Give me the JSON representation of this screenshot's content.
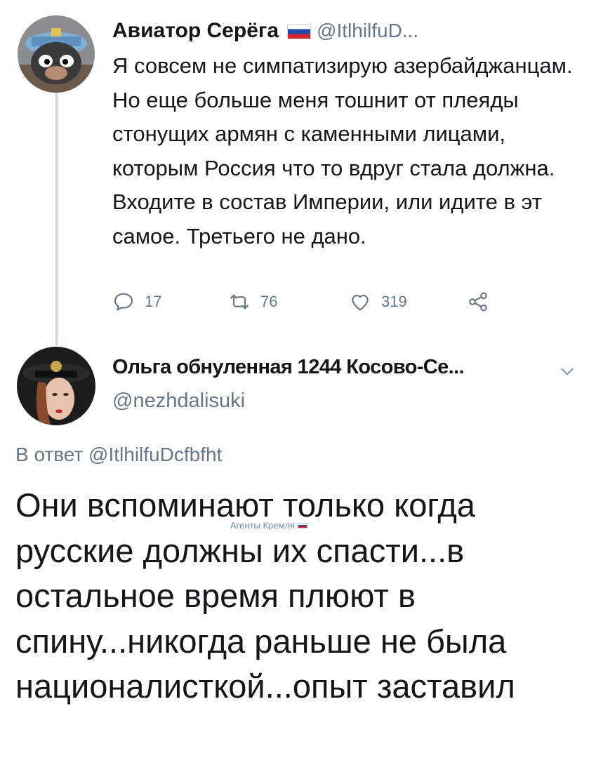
{
  "tweet1": {
    "author_name": "Авиатор Серёга",
    "flag_icon": "russia-flag",
    "handle": "@ItlhilfuD...",
    "text": "Я совсем не симпатизирую азербайджанцам. Но еще больше меня тошнит от плеяды стонущих армян с каменными лицами, которым Россия что то вдруг стала должна. Входите в состав Империи, или идите в эт самое. Третьего не дано.",
    "actions": {
      "replies": "17",
      "retweets": "76",
      "likes": "319"
    }
  },
  "tweet2": {
    "author_name": "Ольга обнуленная 1244 Косово-Се...",
    "handle": "@nezhdalisuki",
    "reply_prefix": "В ответ",
    "reply_to": "@ItlhilfuDcfbfht",
    "text": "Они вспоминают только когда русские должны их спасти...в остальное время плюют в спину...никогда раньше не была националисткой...опыт заставил"
  },
  "watermark": {
    "text": "Агенты Кремля"
  },
  "colors": {
    "text": "#14171a",
    "secondary": "#657786",
    "thread_line": "#ccd6dd"
  }
}
